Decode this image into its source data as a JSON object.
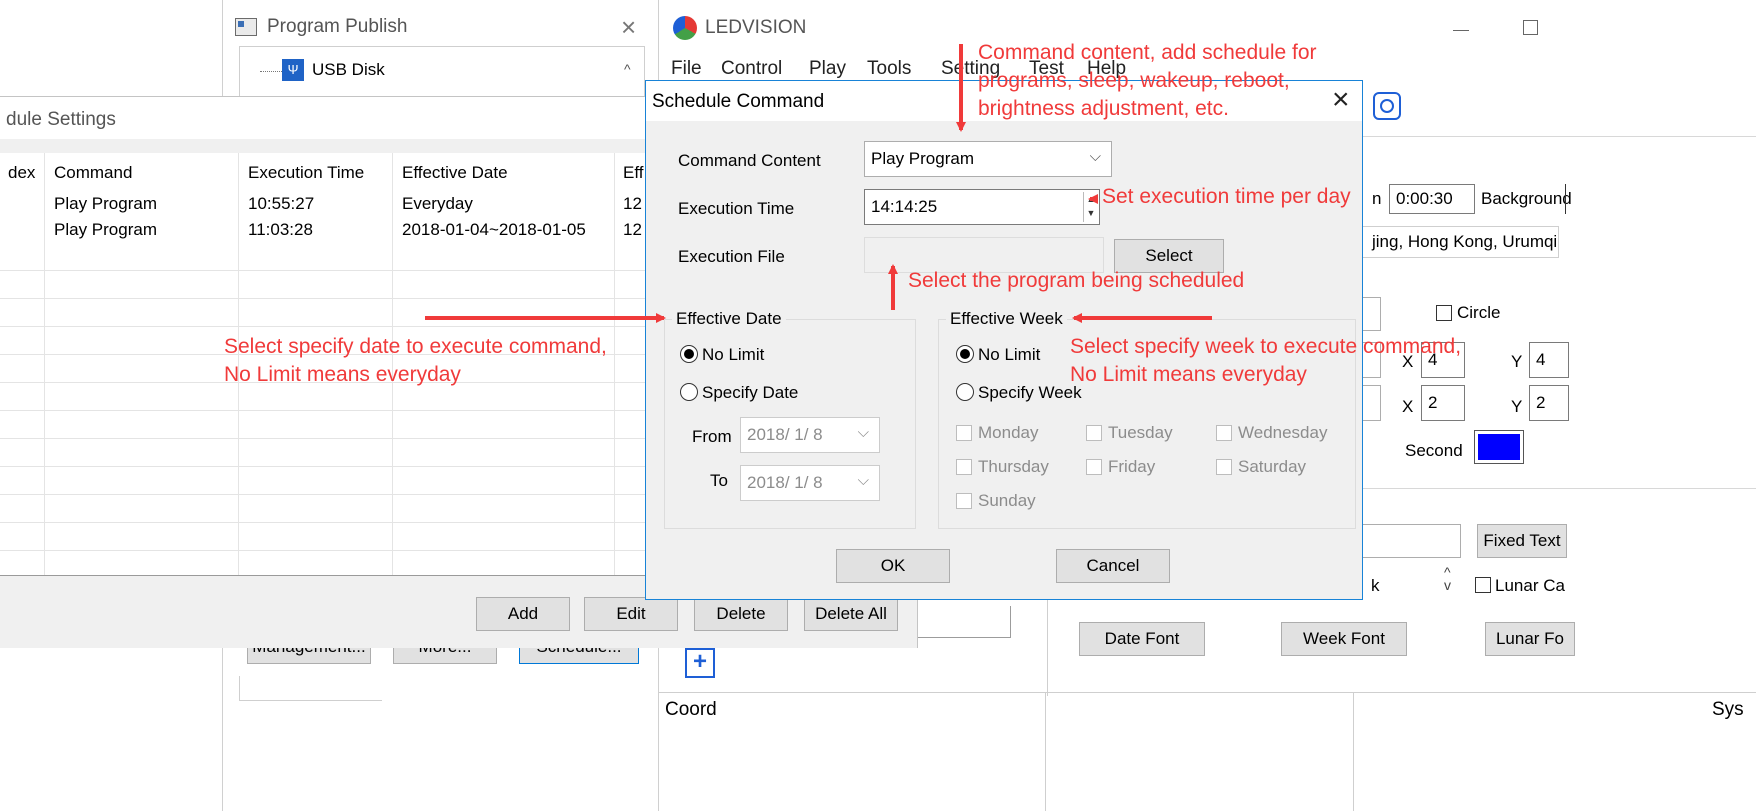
{
  "program_publish": {
    "title": "Program Publish",
    "tree_item_usb": "USB Disk",
    "buttons": {
      "management": "Management...",
      "more": "More...",
      "schedule": "Schedule..."
    }
  },
  "ledvision": {
    "title": "LEDVISION",
    "menu": [
      "File",
      "Control",
      "Play",
      "Tools",
      "Setting",
      "Test",
      "Help"
    ],
    "duration_tail": "n",
    "duration": "0:00:30",
    "background_label": "Background",
    "timezone": "jing, Hong Kong, Urumqi",
    "circle_label": "Circle",
    "x_label": "X",
    "y_label": "Y",
    "x1": "4",
    "y1": "4",
    "x2": "2",
    "y2": "2",
    "second_label": "Second",
    "second_color": "#0000ff",
    "fixed_text": "Fixed Text",
    "lunar_label": "Lunar Ca",
    "k_label": "k",
    "date_font": "Date Font",
    "week_font": "Week Font",
    "lunar_font": "Lunar Fo",
    "status_coord": "Coord",
    "status_sys": "Sys"
  },
  "schedule_settings": {
    "title": "dule Settings",
    "columns": [
      "dex",
      "Command",
      "Execution Time",
      "Effective Date",
      "Eff"
    ],
    "rows": [
      {
        "command": "Play Program",
        "time": "10:55:27",
        "date": "Everyday",
        "eff": "12"
      },
      {
        "command": "Play Program",
        "time": "11:03:28",
        "date": "2018-01-04~2018-01-05",
        "eff": "12"
      }
    ],
    "buttons": {
      "add": "Add",
      "edit": "Edit",
      "delete": "Delete",
      "delete_all": "Delete All"
    }
  },
  "schedule_command": {
    "title": "Schedule Command",
    "command_content_label": "Command Content",
    "command_content_value": "Play Program",
    "execution_time_label": "Execution Time",
    "execution_time_value": "14:14:25",
    "execution_file_label": "Execution File",
    "execution_file_value": "",
    "select_button": "Select",
    "effective_date": {
      "label": "Effective Date",
      "no_limit": "No Limit",
      "specify": "Specify Date",
      "from_label": "From",
      "from_value": "2018/ 1/ 8",
      "to_label": "To",
      "to_value": "2018/ 1/ 8"
    },
    "effective_week": {
      "label": "Effective Week",
      "no_limit": "No Limit",
      "specify": "Specify Week",
      "days": [
        "Monday",
        "Tuesday",
        "Wednesday",
        "Thursday",
        "Friday",
        "Saturday",
        "Sunday"
      ]
    },
    "ok": "OK",
    "cancel": "Cancel"
  },
  "annotations": {
    "command_content_line1": "Command content, add schedule for",
    "command_content_line2": "programs, sleep, wakeup, reboot,",
    "command_content_line3": "brightness adjustment, etc.",
    "execution_time": "Set execution time per day",
    "select_program": "Select the program being scheduled",
    "date_line1": "Select specify date to execute command,",
    "date_line2": "No Limit means everyday",
    "week_line1": "Select specify week to execute command,",
    "week_line2": "No Limit means everyday"
  },
  "colors": {
    "annotation": "#f03a3a",
    "dialog_border": "#1883d7",
    "accent": "#0078d7"
  }
}
